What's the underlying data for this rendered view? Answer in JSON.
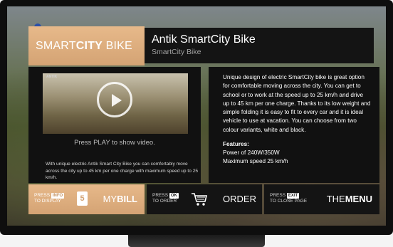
{
  "brand": {
    "prefix": "SMART",
    "highlight": "CITY",
    "suffix": " BIKE"
  },
  "header": {
    "title": "Antik SmartCity Bike",
    "subtitle": "SmartCity Bike"
  },
  "video": {
    "logo_text": "ANTIK",
    "caption": "Press PLAY to show video."
  },
  "left_description": "With unique electric Antik Smart City Bike you can comfortably move across the city up to 45 km per one charge with maximum speed up to 25 km/h.",
  "right_description": "Unique design of electric SmartCity bike is great option for comfortable moving across the city. You can get to school or to work at the speed up to 25 km/h and drive up to 45 km per one charge. Thanks to its low weight and simple folding it is easy to fit to every car and it is ideal vehicle to use at vacation. You can choose from two colour variants, white and black.",
  "features": {
    "heading": "Features:",
    "items": [
      "Power of 240W/350W",
      "Maximum speed 25 km/h"
    ]
  },
  "bottom_bar": {
    "bill": {
      "press": "PRESS",
      "key": "INFO",
      "action": "TO DISPLAY",
      "icon_glyph": "5",
      "label_thin": "MY",
      "label_bold": "BILL"
    },
    "order": {
      "press": "PRESS",
      "key": "OK",
      "action": "TO ORDER",
      "label": "ORDER"
    },
    "menu": {
      "press": "PRESS",
      "key": "EXIT",
      "action": "TO CLOSE PAGE",
      "label_thin": "THE",
      "label_bold": "MENU"
    }
  },
  "colors": {
    "accent": "#d4a374",
    "panel": "#141414",
    "text": "#ffffff"
  }
}
